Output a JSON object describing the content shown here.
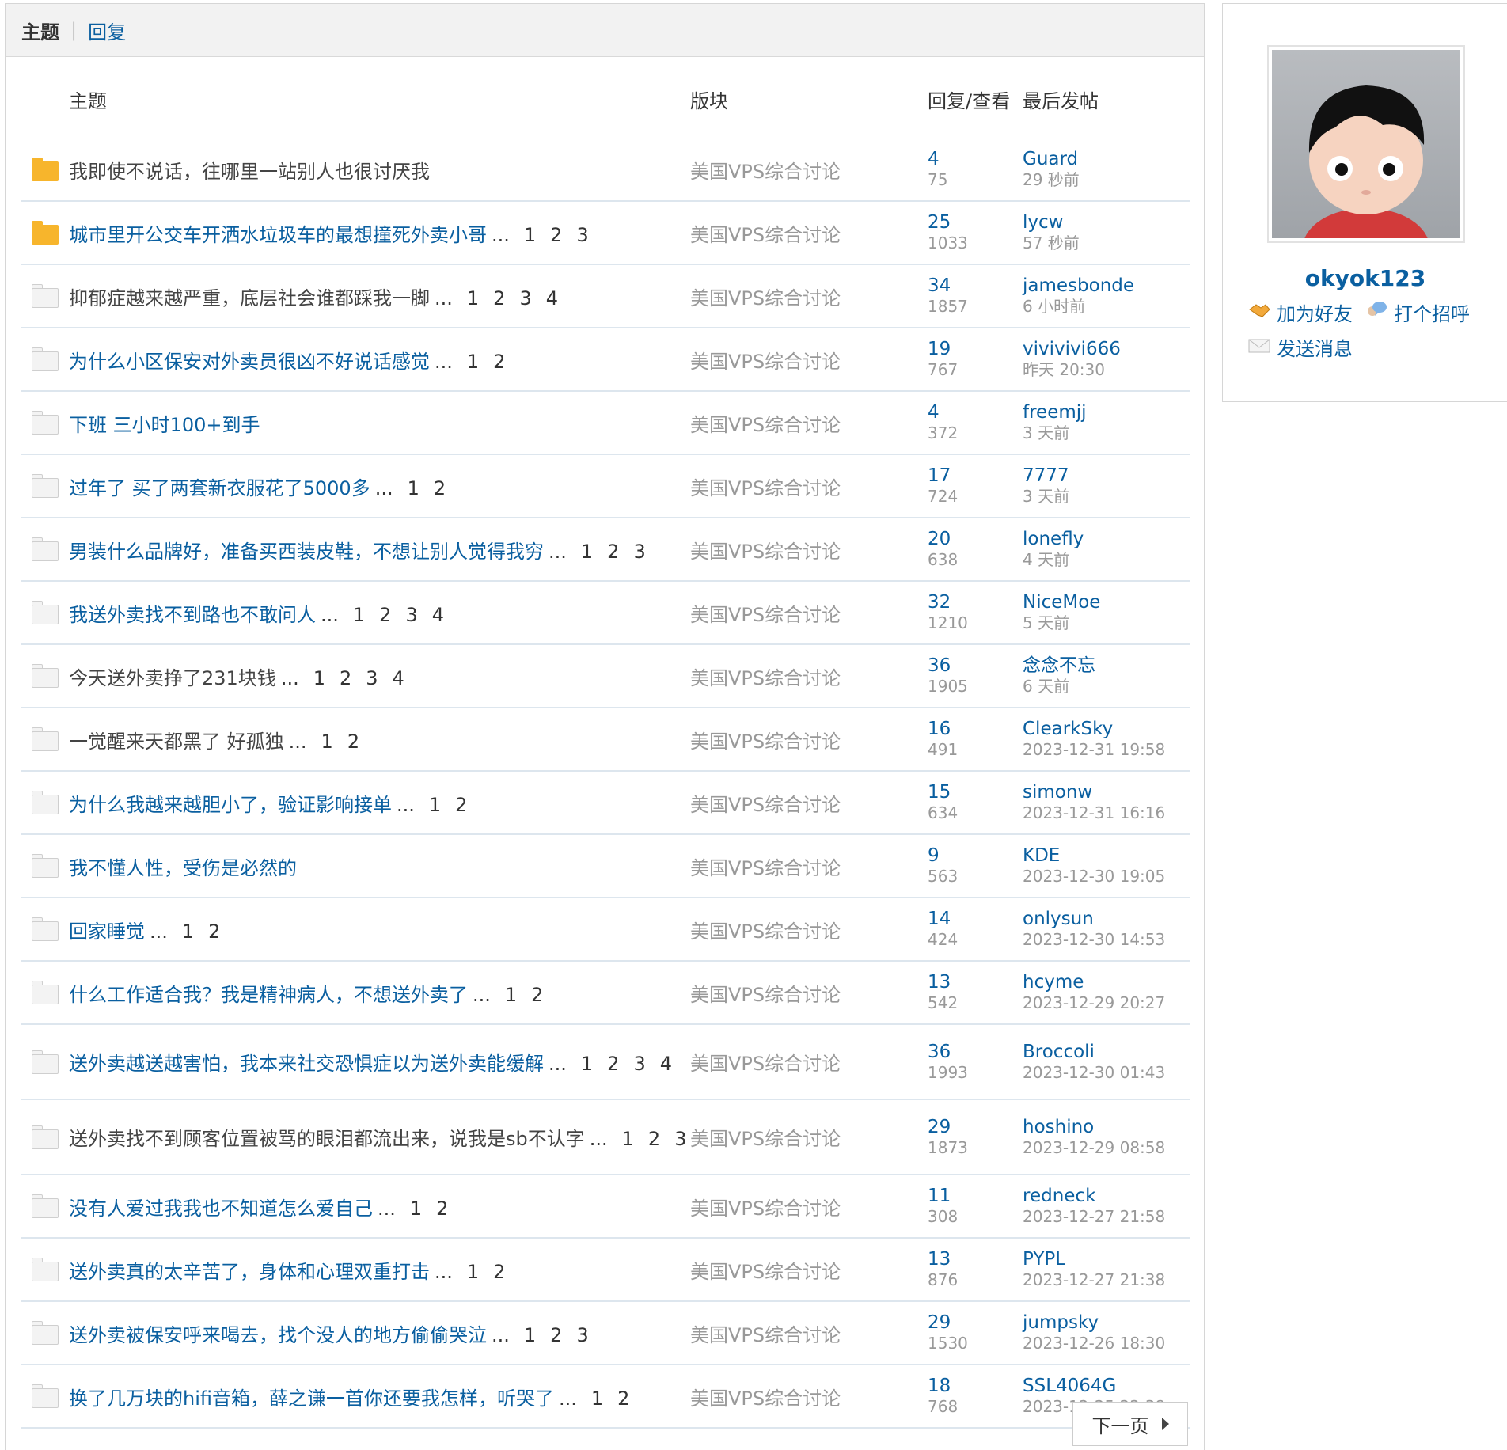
{
  "tabs": {
    "active": "主题",
    "other": "回复"
  },
  "columns": {
    "title": "主题",
    "forum": "版块",
    "stats": "回复/查看",
    "last": "最后发帖"
  },
  "threads": [
    {
      "title": "我即使不说话，往哪里一站别人也很讨厌我",
      "read": true,
      "hot": true,
      "pages": [],
      "forum": "美国VPS综合讨论",
      "replies": "4",
      "views": "75",
      "last_user": "Guard",
      "last_time": "29 秒前"
    },
    {
      "title": "城市里开公交车开洒水垃圾车的最想撞死外卖小哥",
      "read": false,
      "hot": true,
      "pages": [
        "1",
        "2",
        "3"
      ],
      "forum": "美国VPS综合讨论",
      "replies": "25",
      "views": "1033",
      "last_user": "lycw",
      "last_time": "57 秒前"
    },
    {
      "title": "抑郁症越来越严重，底层社会谁都踩我一脚",
      "read": true,
      "hot": false,
      "pages": [
        "1",
        "2",
        "3",
        "4"
      ],
      "forum": "美国VPS综合讨论",
      "replies": "34",
      "views": "1857",
      "last_user": "jamesbonde",
      "last_time": "6 小时前"
    },
    {
      "title": "为什么小区保安对外卖员很凶不好说话感觉",
      "read": false,
      "hot": false,
      "pages": [
        "1",
        "2"
      ],
      "forum": "美国VPS综合讨论",
      "replies": "19",
      "views": "767",
      "last_user": "vivivivi666",
      "last_time": "昨天 20:30"
    },
    {
      "title": "下班 三小时100+到手",
      "read": false,
      "hot": false,
      "pages": [],
      "forum": "美国VPS综合讨论",
      "replies": "4",
      "views": "372",
      "last_user": "freemjj",
      "last_time": "3 天前"
    },
    {
      "title": "过年了 买了两套新衣服花了5000多",
      "read": false,
      "hot": false,
      "pages": [
        "1",
        "2"
      ],
      "forum": "美国VPS综合讨论",
      "replies": "17",
      "views": "724",
      "last_user": "7777",
      "last_time": "3 天前"
    },
    {
      "title": "男装什么品牌好，准备买西装皮鞋，不想让别人觉得我穷",
      "read": false,
      "hot": false,
      "pages": [
        "1",
        "2",
        "3"
      ],
      "forum": "美国VPS综合讨论",
      "replies": "20",
      "views": "638",
      "last_user": "lonefly",
      "last_time": "4 天前"
    },
    {
      "title": "我送外卖找不到路也不敢问人",
      "read": false,
      "hot": false,
      "pages": [
        "1",
        "2",
        "3",
        "4"
      ],
      "forum": "美国VPS综合讨论",
      "replies": "32",
      "views": "1210",
      "last_user": "NiceMoe",
      "last_time": "5 天前"
    },
    {
      "title": "今天送外卖挣了231块钱",
      "read": true,
      "hot": false,
      "pages": [
        "1",
        "2",
        "3",
        "4"
      ],
      "forum": "美国VPS综合讨论",
      "replies": "36",
      "views": "1905",
      "last_user": "念念不忘",
      "last_time": "6 天前"
    },
    {
      "title": "一觉醒来天都黑了 好孤独",
      "read": true,
      "hot": false,
      "pages": [
        "1",
        "2"
      ],
      "forum": "美国VPS综合讨论",
      "replies": "16",
      "views": "491",
      "last_user": "ClearkSky",
      "last_time": "2023-12-31 19:58"
    },
    {
      "title": "为什么我越来越胆小了，验证影响接单",
      "read": false,
      "hot": false,
      "pages": [
        "1",
        "2"
      ],
      "forum": "美国VPS综合讨论",
      "replies": "15",
      "views": "634",
      "last_user": "simonw",
      "last_time": "2023-12-31 16:16"
    },
    {
      "title": "我不懂人性，受伤是必然的",
      "read": false,
      "hot": false,
      "pages": [],
      "forum": "美国VPS综合讨论",
      "replies": "9",
      "views": "563",
      "last_user": "KDE",
      "last_time": "2023-12-30 19:05"
    },
    {
      "title": "回家睡觉",
      "read": false,
      "hot": false,
      "pages": [
        "1",
        "2"
      ],
      "forum": "美国VPS综合讨论",
      "replies": "14",
      "views": "424",
      "last_user": "onlysun",
      "last_time": "2023-12-30 14:53"
    },
    {
      "title": "什么工作适合我？我是精神病人，不想送外卖了",
      "read": false,
      "hot": false,
      "pages": [
        "1",
        "2"
      ],
      "forum": "美国VPS综合讨论",
      "replies": "13",
      "views": "542",
      "last_user": "hcyme",
      "last_time": "2023-12-29 20:27"
    },
    {
      "title": "送外卖越送越害怕，我本来社交恐惧症以为送外卖能缓解",
      "read": false,
      "hot": false,
      "tall": true,
      "pages": [
        "1",
        "2",
        "3",
        "4"
      ],
      "forum": "美国VPS综合讨论",
      "replies": "36",
      "views": "1993",
      "last_user": "Broccoli",
      "last_time": "2023-12-30 01:43"
    },
    {
      "title": "送外卖找不到顾客位置被骂的眼泪都流出来，说我是sb不认字",
      "read": true,
      "hot": false,
      "tall": true,
      "pages": [
        "1",
        "2",
        "3"
      ],
      "forum": "美国VPS综合讨论",
      "replies": "29",
      "views": "1873",
      "last_user": "hoshino",
      "last_time": "2023-12-29 08:58"
    },
    {
      "title": "没有人爱过我我也不知道怎么爱自己",
      "read": false,
      "hot": false,
      "pages": [
        "1",
        "2"
      ],
      "forum": "美国VPS综合讨论",
      "replies": "11",
      "views": "308",
      "last_user": "redneck",
      "last_time": "2023-12-27 21:58"
    },
    {
      "title": "送外卖真的太辛苦了，身体和心理双重打击",
      "read": false,
      "hot": false,
      "pages": [
        "1",
        "2"
      ],
      "forum": "美国VPS综合讨论",
      "replies": "13",
      "views": "876",
      "last_user": "PYPL",
      "last_time": "2023-12-27 21:38"
    },
    {
      "title": "送外卖被保安呼来喝去，找个没人的地方偷偷哭泣",
      "read": false,
      "hot": false,
      "pages": [
        "1",
        "2",
        "3"
      ],
      "forum": "美国VPS综合讨论",
      "replies": "29",
      "views": "1530",
      "last_user": "jumpsky",
      "last_time": "2023-12-26 18:30"
    },
    {
      "title": "换了几万块的hifi音箱，薛之谦一首你还要我怎样，听哭了",
      "read": false,
      "hot": false,
      "pages": [
        "1",
        "2"
      ],
      "forum": "美国VPS综合讨论",
      "replies": "18",
      "views": "768",
      "last_user": "SSL4064G",
      "last_time": "2023-12-25 22:38"
    }
  ],
  "ellipsis": "...",
  "pagination": {
    "next_label": "下一页"
  },
  "profile": {
    "username": "okyok123",
    "add_friend": "加为好友",
    "say_hi": "打个招呼",
    "send_message": "发送消息"
  },
  "colors": {
    "link": "#0a5fa0",
    "muted": "#999999",
    "hot_folder": "#f7b52c"
  }
}
